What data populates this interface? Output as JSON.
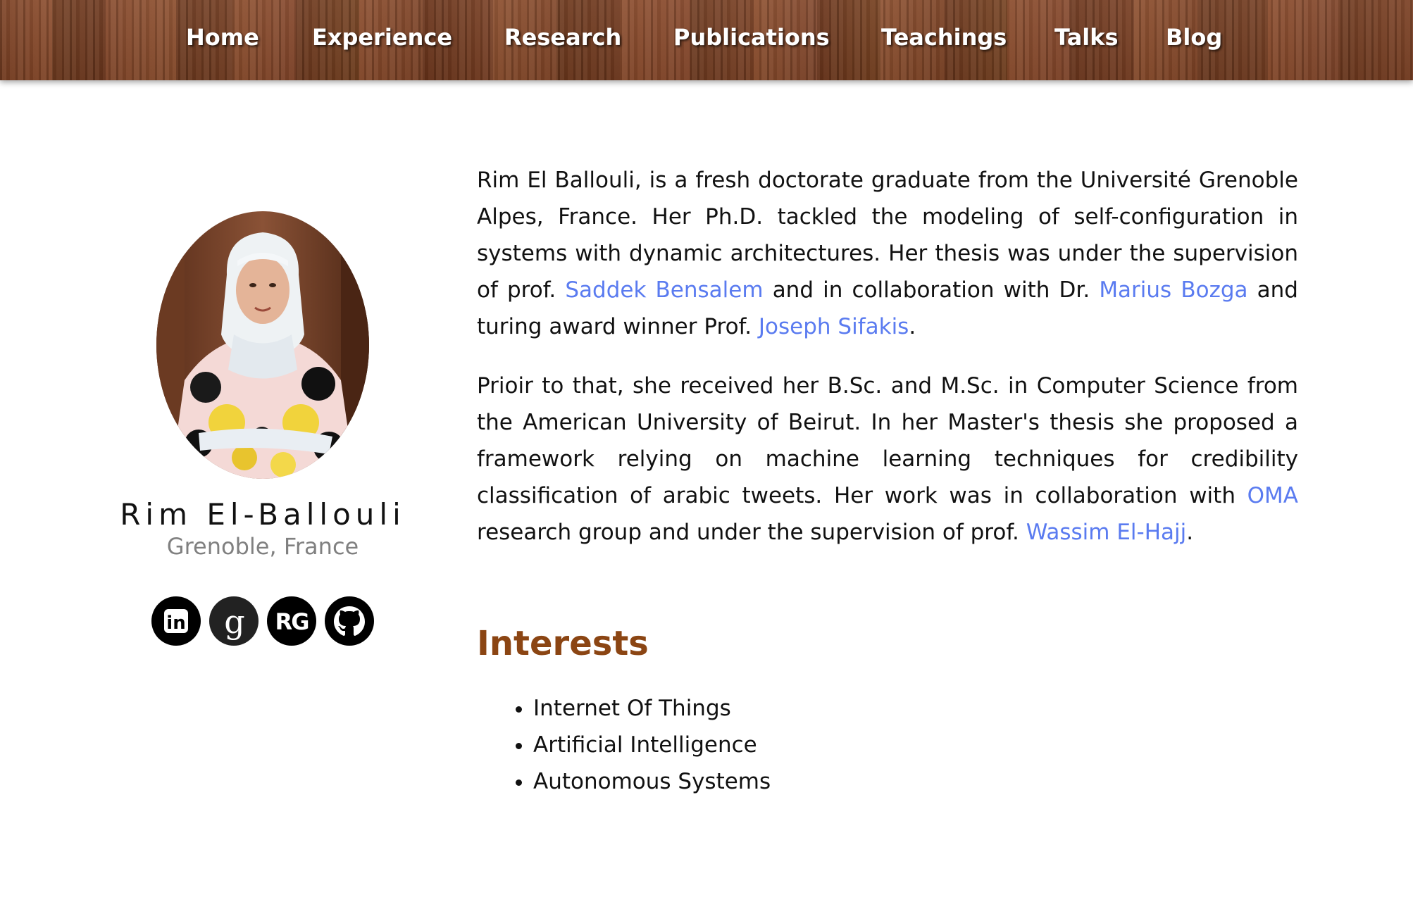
{
  "nav": {
    "items": [
      {
        "label": "Home"
      },
      {
        "label": "Experience"
      },
      {
        "label": "Research"
      },
      {
        "label": "Publications"
      },
      {
        "label": "Teachings"
      },
      {
        "label": "Talks"
      },
      {
        "label": "Blog"
      }
    ]
  },
  "profile": {
    "name": "Rim El-Ballouli",
    "location": "Grenoble, France",
    "social": [
      {
        "icon": "linkedin-icon",
        "label": "in"
      },
      {
        "icon": "google-scholar-icon",
        "label": "g"
      },
      {
        "icon": "researchgate-icon",
        "label": "RG"
      },
      {
        "icon": "github-icon",
        "label": ""
      }
    ]
  },
  "bio": {
    "p1": {
      "t1": "Rim El Ballouli, is a fresh doctorate graduate from the Université Grenoble Alpes, France. Her Ph.D. tackled the modeling of self-configuration in systems with dynamic architectures. Her thesis was under the supervision of prof. ",
      "link1": "Saddek Bensalem",
      "t2": " and in collaboration with Dr. ",
      "link2": "Marius Bozga",
      "t3": " and turing award winner Prof. ",
      "link3": "Joseph Sifakis",
      "t4": "."
    },
    "p2": {
      "t1": "Prioir to that, she received her B.Sc. and M.Sc. in Computer Science from the American University of Beirut. In her Master's thesis she proposed a framework relying on machine learning techniques for credibility classification of arabic tweets. Her work was in collaboration with ",
      "link1": "OMA",
      "t2": " research group and under the supervision of prof. ",
      "link2": "Wassim El-Hajj",
      "t3": "."
    }
  },
  "interests": {
    "title": "Interests",
    "items": [
      "Internet Of Things",
      "Artificial Intelligence",
      "Autonomous Systems"
    ]
  },
  "colors": {
    "link": "#5a7bf0",
    "heading": "#8b4513",
    "nav_wood": "#7a3f22",
    "location": "#808080"
  }
}
